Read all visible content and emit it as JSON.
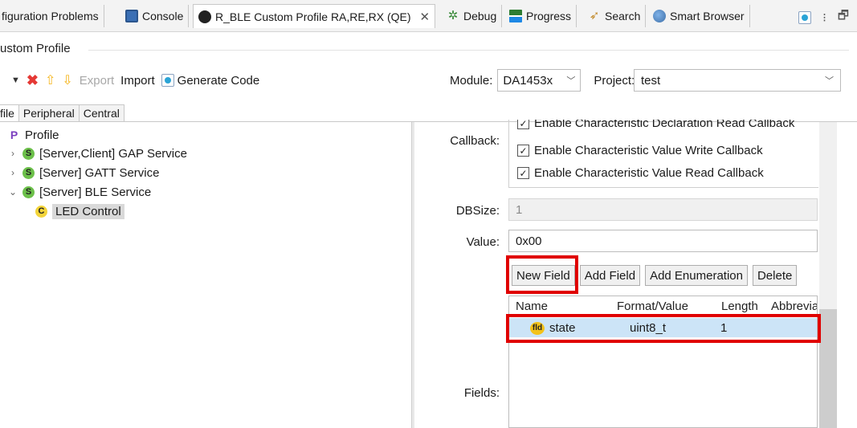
{
  "tabs": [
    {
      "label": "figuration Problems"
    },
    {
      "label": "Console"
    },
    {
      "label": "R_BLE Custom Profile RA,RE,RX (QE)"
    },
    {
      "label": "Debug"
    },
    {
      "label": "Progress"
    },
    {
      "label": "Search"
    },
    {
      "label": "Smart Browser"
    }
  ],
  "panel": {
    "title": "ustom Profile"
  },
  "toolbar": {
    "export_label": "Export",
    "import_label": "Import",
    "generate_label": "Generate Code"
  },
  "module": {
    "label": "Module:",
    "value": "DA1453x"
  },
  "project": {
    "label": "Project:",
    "value": "test"
  },
  "subtabs": [
    {
      "label": "file"
    },
    {
      "label": "Peripheral"
    },
    {
      "label": "Central"
    }
  ],
  "tree": [
    {
      "badge": "P",
      "label": "Profile"
    },
    {
      "badge": "S",
      "label": "[Server,Client] GAP Service"
    },
    {
      "badge": "S",
      "label": "[Server] GATT Service"
    },
    {
      "badge": "S",
      "label": "[Server] BLE Service"
    },
    {
      "badge": "C",
      "label": "LED Control"
    }
  ],
  "details": {
    "callback_label": "Callback:",
    "callbacks": [
      {
        "label": "Enable Characteristic Declaration Read Callback",
        "checked": true
      },
      {
        "label": "Enable Characteristic Value Write Callback",
        "checked": true
      },
      {
        "label": "Enable Characteristic Value Read Callback",
        "checked": true
      }
    ],
    "dbsize_label": "DBSize:",
    "dbsize_value": "1",
    "value_label": "Value:",
    "value_value": "0x00",
    "fields_label": "Fields:"
  },
  "buttons": {
    "new_field": "New Field",
    "add_field": "Add Field",
    "add_enumeration": "Add Enumeration",
    "delete": "Delete"
  },
  "fields_table": {
    "columns": [
      "Name",
      "Format/Value",
      "Length",
      "Abbrevia"
    ],
    "rows": [
      {
        "badge": "fld",
        "name": "state",
        "format": "uint8_t",
        "length": "1",
        "abbreviation": ""
      }
    ]
  },
  "colors": {
    "highlight": "#e00000",
    "selection": "#cce4f7"
  }
}
